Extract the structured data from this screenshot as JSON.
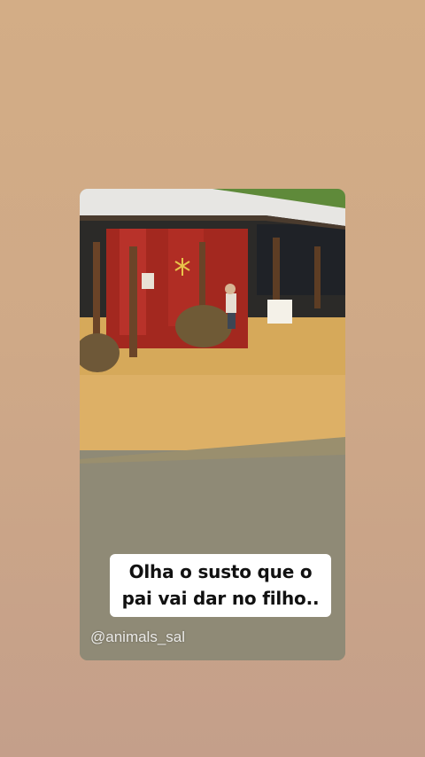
{
  "story": {
    "caption": "Olha o susto que o pai vai dar no filho..",
    "username_watermark": "@animals_sal"
  },
  "colors": {
    "background_top": "#d3ad86",
    "background_bottom": "#c49f8a",
    "barn_red": "#a3281f",
    "roof": "#e7e6e3",
    "grass_sunlit": "#d6a95a",
    "grass_shade": "#8f8a76"
  }
}
